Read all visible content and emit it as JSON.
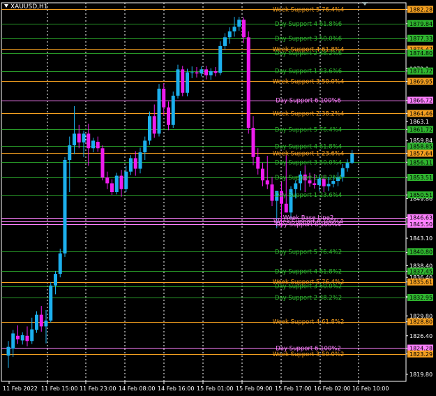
{
  "window": {
    "symbol_title": "XAUUSD,H1"
  },
  "chart_data": {
    "type": "candlestick",
    "symbol": "XAUUSD",
    "timeframe": "H1",
    "ylim": [
      1818.6,
      1883.4
    ],
    "y_ticks": [
      "1882.28",
      "1879.84",
      "1877.33",
      "1875.47",
      "1872.1",
      "1871.72",
      "1869.95",
      "1866.72",
      "1864.46",
      "1863.1",
      "1861.72",
      "1859.84",
      "1857.64",
      "1856.11",
      "1853.51",
      "1850.51",
      "1849.86",
      "1846.63",
      "1845.50",
      "1843.10",
      "1840.65",
      "1838.40",
      "1837.45",
      "1836.40",
      "1835.61",
      "1833.10",
      "1832.95",
      "1829.80",
      "1828.80",
      "1826.40",
      "1824.28",
      "1823.29",
      "1819.80"
    ],
    "x_ticks": [
      "11 Feb 2022",
      "11 Feb 15:00",
      "11 Feb 23:00",
      "14 Feb 08:00",
      "14 Feb 16:00",
      "15 Feb 01:00",
      "15 Feb 09:00",
      "15 Feb 17:00",
      "16 Feb 02:00",
      "16 Feb 10:00"
    ],
    "levels": [
      {
        "price": 1882.28,
        "label": "Week Support 5 76.4%4",
        "color": "#f5a020",
        "badge": "1882.28"
      },
      {
        "price": 1879.84,
        "label": "Day Support 4 61.8%6",
        "color": "#2fb52f",
        "badge": "1879.84"
      },
      {
        "price": 1877.33,
        "label": "Day Support 3 50.0%6",
        "color": "#2fb52f",
        "badge": "1877.33"
      },
      {
        "price": 1875.47,
        "label": "Week Support 4 61.8%4",
        "color": "#f5a020",
        "badge": "1875.47"
      },
      {
        "price": 1874.8,
        "label": "Day Support 2 38.2%6",
        "color": "#2fb52f",
        "badge": "1874.80"
      },
      {
        "price": 1871.72,
        "label": "Day Support 1 23.6%6",
        "color": "#2fb52f",
        "badge": "1871.72"
      },
      {
        "price": 1869.95,
        "label": "Week Support 3 50.0%4",
        "color": "#f5a020",
        "badge": "1869.95"
      },
      {
        "price": 1866.72,
        "label": "Day Support 6 100%6",
        "color": "#ff80ff",
        "badge": "1866.72"
      },
      {
        "price": 1864.46,
        "label": "Week Support 2 38.2%4",
        "color": "#f5a020",
        "badge": "1864.46"
      },
      {
        "price": 1861.72,
        "label": "Day Support 5 76.4%4",
        "color": "#2fb52f",
        "badge": "1861.72"
      },
      {
        "price": 1858.85,
        "label": "Day Support 4 61.8%4",
        "color": "#2fb52f",
        "badge": "1858.85"
      },
      {
        "price": 1857.64,
        "label": "Week Support 1 23.6%4",
        "color": "#f5a020",
        "badge": "1857.64"
      },
      {
        "price": 1856.11,
        "label": "Day Support 3 50.0%4",
        "color": "#2fb52f",
        "badge": "1856.11"
      },
      {
        "price": 1853.51,
        "label": "Day Support 2 38.2%4",
        "color": "#2fb52f",
        "badge": "1853.51"
      },
      {
        "price": 1850.51,
        "label": "Day Support 1 23.6%4",
        "color": "#2fb52f",
        "badge": "1850.51"
      },
      {
        "price": 1846.63,
        "label": "Week Base Line2",
        "color": "#ff80ff",
        "badge": "1846.63"
      },
      {
        "price": 1845.95,
        "label": "Week Support 6 100%4",
        "color": "#ff80ff",
        "badge": ""
      },
      {
        "price": 1845.5,
        "label": "Day Support 6 100%4",
        "color": "#ff80ff",
        "badge": "1845.50"
      },
      {
        "price": 1840.8,
        "label": "Day Support 5 76.4%2",
        "color": "#2fb52f",
        "badge": "1840.80"
      },
      {
        "price": 1837.45,
        "label": "Day Support 4 61.8%2",
        "color": "#2fb52f",
        "badge": "1837.45"
      },
      {
        "price": 1835.61,
        "label": "Week Support 5 76.4%2",
        "color": "#f5a020",
        "badge": "1835.61"
      },
      {
        "price": 1834.9,
        "label": "Day Support 3 50.0%2",
        "color": "#2fb52f",
        "badge": ""
      },
      {
        "price": 1832.95,
        "label": "Day Support 2 38.2%2",
        "color": "#2fb52f",
        "badge": "1832.95"
      },
      {
        "price": 1828.8,
        "label": "Week Support 4 61.8%2",
        "color": "#f5a020",
        "badge": "1828.80"
      },
      {
        "price": 1824.28,
        "label": "Day Support 6 100%2",
        "color": "#ff80ff",
        "badge": "1824.28"
      },
      {
        "price": 1823.29,
        "label": "Week Support 3 50.0%2",
        "color": "#f5a020",
        "badge": "1823.29"
      }
    ],
    "candles": [
      {
        "o": 1823.0,
        "h": 1825.5,
        "l": 1820.9,
        "c": 1824.5
      },
      {
        "o": 1824.2,
        "h": 1827.4,
        "l": 1822.8,
        "c": 1826.8
      },
      {
        "o": 1826.4,
        "h": 1828.2,
        "l": 1825.0,
        "c": 1825.8
      },
      {
        "o": 1825.6,
        "h": 1827.0,
        "l": 1824.9,
        "c": 1826.5
      },
      {
        "o": 1826.4,
        "h": 1828.0,
        "l": 1824.6,
        "c": 1825.5
      },
      {
        "o": 1825.5,
        "h": 1829.5,
        "l": 1825.0,
        "c": 1827.5
      },
      {
        "o": 1827.4,
        "h": 1830.6,
        "l": 1826.9,
        "c": 1830.0
      },
      {
        "o": 1830.0,
        "h": 1831.5,
        "l": 1827.1,
        "c": 1828.0
      },
      {
        "o": 1828.0,
        "h": 1830.8,
        "l": 1825.1,
        "c": 1829.0
      },
      {
        "o": 1829.0,
        "h": 1835.6,
        "l": 1828.7,
        "c": 1835.0
      },
      {
        "o": 1835.0,
        "h": 1837.5,
        "l": 1833.5,
        "c": 1837.0
      },
      {
        "o": 1837.0,
        "h": 1841.3,
        "l": 1836.4,
        "c": 1840.5
      },
      {
        "o": 1840.5,
        "h": 1857.0,
        "l": 1839.9,
        "c": 1856.5
      },
      {
        "o": 1856.5,
        "h": 1860.5,
        "l": 1851.0,
        "c": 1859.0
      },
      {
        "o": 1859.0,
        "h": 1865.7,
        "l": 1857.5,
        "c": 1861.0
      },
      {
        "o": 1861.0,
        "h": 1862.5,
        "l": 1858.5,
        "c": 1859.5
      },
      {
        "o": 1859.5,
        "h": 1861.5,
        "l": 1857.0,
        "c": 1861.0
      },
      {
        "o": 1861.0,
        "h": 1862.7,
        "l": 1855.5,
        "c": 1858.5
      },
      {
        "o": 1858.5,
        "h": 1860.3,
        "l": 1857.8,
        "c": 1859.8
      },
      {
        "o": 1859.6,
        "h": 1860.5,
        "l": 1857.9,
        "c": 1858.5
      },
      {
        "o": 1858.5,
        "h": 1859.0,
        "l": 1853.0,
        "c": 1853.5
      },
      {
        "o": 1853.5,
        "h": 1854.5,
        "l": 1851.5,
        "c": 1852.5
      },
      {
        "o": 1852.5,
        "h": 1853.2,
        "l": 1850.5,
        "c": 1851.0
      },
      {
        "o": 1851.0,
        "h": 1854.3,
        "l": 1850.6,
        "c": 1853.8
      },
      {
        "o": 1853.8,
        "h": 1854.8,
        "l": 1850.2,
        "c": 1851.5
      },
      {
        "o": 1851.5,
        "h": 1855.5,
        "l": 1851.0,
        "c": 1854.5
      },
      {
        "o": 1854.5,
        "h": 1857.3,
        "l": 1853.9,
        "c": 1856.8
      },
      {
        "o": 1856.8,
        "h": 1858.0,
        "l": 1853.8,
        "c": 1855.0
      },
      {
        "o": 1855.0,
        "h": 1858.6,
        "l": 1854.2,
        "c": 1857.8
      },
      {
        "o": 1857.8,
        "h": 1860.5,
        "l": 1856.5,
        "c": 1859.8
      },
      {
        "o": 1859.8,
        "h": 1864.8,
        "l": 1859.1,
        "c": 1864.0
      },
      {
        "o": 1864.0,
        "h": 1866.0,
        "l": 1860.3,
        "c": 1861.0
      },
      {
        "o": 1861.0,
        "h": 1869.5,
        "l": 1860.5,
        "c": 1868.7
      },
      {
        "o": 1868.7,
        "h": 1869.6,
        "l": 1864.1,
        "c": 1865.5
      },
      {
        "o": 1865.5,
        "h": 1866.5,
        "l": 1861.6,
        "c": 1862.5
      },
      {
        "o": 1862.5,
        "h": 1868.2,
        "l": 1862.0,
        "c": 1867.5
      },
      {
        "o": 1867.5,
        "h": 1872.8,
        "l": 1867.0,
        "c": 1872.0
      },
      {
        "o": 1872.0,
        "h": 1872.6,
        "l": 1867.4,
        "c": 1868.0
      },
      {
        "o": 1868.0,
        "h": 1872.1,
        "l": 1867.4,
        "c": 1871.5
      },
      {
        "o": 1871.5,
        "h": 1872.5,
        "l": 1870.5,
        "c": 1871.5
      },
      {
        "o": 1871.5,
        "h": 1872.4,
        "l": 1870.6,
        "c": 1871.3
      },
      {
        "o": 1871.3,
        "h": 1872.5,
        "l": 1870.8,
        "c": 1872.0
      },
      {
        "o": 1872.0,
        "h": 1872.6,
        "l": 1870.3,
        "c": 1871.0
      },
      {
        "o": 1871.0,
        "h": 1872.2,
        "l": 1870.2,
        "c": 1871.7
      },
      {
        "o": 1871.7,
        "h": 1872.4,
        "l": 1870.8,
        "c": 1871.4
      },
      {
        "o": 1871.4,
        "h": 1876.8,
        "l": 1871.0,
        "c": 1876.0
      },
      {
        "o": 1876.0,
        "h": 1878.2,
        "l": 1875.3,
        "c": 1877.5
      },
      {
        "o": 1877.5,
        "h": 1879.2,
        "l": 1876.4,
        "c": 1878.5
      },
      {
        "o": 1878.5,
        "h": 1881.0,
        "l": 1877.6,
        "c": 1879.3
      },
      {
        "o": 1879.3,
        "h": 1881.0,
        "l": 1878.6,
        "c": 1880.5
      },
      {
        "o": 1880.5,
        "h": 1880.9,
        "l": 1876.5,
        "c": 1877.5
      },
      {
        "o": 1877.5,
        "h": 1878.5,
        "l": 1861.0,
        "c": 1862.0
      },
      {
        "o": 1862.0,
        "h": 1864.0,
        "l": 1855.6,
        "c": 1857.0
      },
      {
        "o": 1857.0,
        "h": 1858.5,
        "l": 1854.0,
        "c": 1855.0
      },
      {
        "o": 1855.0,
        "h": 1856.0,
        "l": 1852.0,
        "c": 1853.0
      },
      {
        "o": 1853.0,
        "h": 1857.2,
        "l": 1851.5,
        "c": 1852.3
      },
      {
        "o": 1852.3,
        "h": 1853.6,
        "l": 1848.6,
        "c": 1849.5
      },
      {
        "o": 1849.5,
        "h": 1851.0,
        "l": 1844.8,
        "c": 1851.2
      },
      {
        "o": 1851.2,
        "h": 1852.7,
        "l": 1845.0,
        "c": 1849.0
      },
      {
        "o": 1849.0,
        "h": 1857.3,
        "l": 1847.5,
        "c": 1847.5
      },
      {
        "o": 1847.5,
        "h": 1852.0,
        "l": 1846.5,
        "c": 1851.5
      },
      {
        "o": 1851.5,
        "h": 1853.0,
        "l": 1849.9,
        "c": 1852.5
      },
      {
        "o": 1852.5,
        "h": 1854.6,
        "l": 1851.3,
        "c": 1854.0
      },
      {
        "o": 1854.0,
        "h": 1855.6,
        "l": 1851.0,
        "c": 1853.0
      },
      {
        "o": 1853.0,
        "h": 1854.3,
        "l": 1851.9,
        "c": 1852.5
      },
      {
        "o": 1852.5,
        "h": 1854.1,
        "l": 1851.6,
        "c": 1852.2
      },
      {
        "o": 1852.2,
        "h": 1853.9,
        "l": 1851.2,
        "c": 1853.3
      },
      {
        "o": 1853.3,
        "h": 1853.9,
        "l": 1851.0,
        "c": 1852.0
      },
      {
        "o": 1852.0,
        "h": 1853.6,
        "l": 1851.2,
        "c": 1852.4
      },
      {
        "o": 1852.4,
        "h": 1853.8,
        "l": 1851.8,
        "c": 1852.9
      },
      {
        "o": 1852.9,
        "h": 1854.4,
        "l": 1852.0,
        "c": 1853.6
      },
      {
        "o": 1853.6,
        "h": 1855.8,
        "l": 1852.8,
        "c": 1855.1
      },
      {
        "o": 1855.1,
        "h": 1856.6,
        "l": 1854.5,
        "c": 1856.0
      },
      {
        "o": 1856.0,
        "h": 1858.2,
        "l": 1855.8,
        "c": 1857.6
      }
    ],
    "colors": {
      "bull": "#1cb0ee",
      "bear": "#ee1cee",
      "background": "#000000",
      "grid": "#ffffff",
      "axis_text": "#ffffff",
      "badge_text": "#000000"
    },
    "vertical_grid": "dotted",
    "legend": "none"
  }
}
